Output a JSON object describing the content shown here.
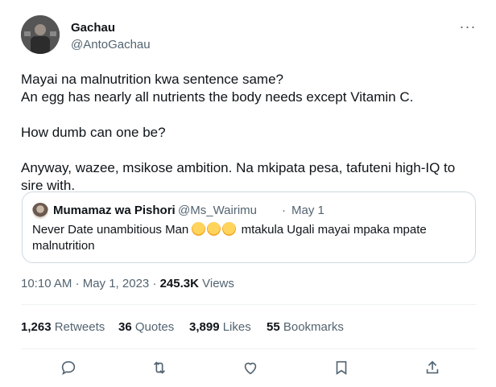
{
  "author": {
    "name": "Gachau",
    "handle": "@AntoGachau",
    "avatar_icon": "profile-photo"
  },
  "more_icon_label": "···",
  "tweet_text": {
    "line1": "Mayai na malnutrition kwa sentence same?",
    "line2": "An egg has nearly all nutrients the body needs except Vitamin C.",
    "line3": "How dumb can one be?",
    "line4": "Anyway, wazee, msikose ambition. Na mkipata pesa, tafuteni high-IQ to sire with."
  },
  "quoted": {
    "name": "Mumamaz wa Pishori",
    "handle": "@Ms_Wairimu",
    "separator": "·",
    "date": "May 1",
    "text_before_emoji": "Never Date unambitious Man ",
    "emoji_icon": "yawning-face-emoji",
    "emoji_count": 3,
    "text_after_emoji": " mtakula Ugali mayai mpaka mpate malnutrition"
  },
  "meta": {
    "time": "10:10 AM · May 1, 2023 · ",
    "views_count": "245.3K",
    "views_label": " Views"
  },
  "stats": {
    "retweets_count": "1,263",
    "retweets_label": " Retweets",
    "quotes_count": "36",
    "quotes_label": " Quotes",
    "likes_count": "3,899",
    "likes_label": " Likes",
    "bookmarks_count": "55",
    "bookmarks_label": " Bookmarks"
  },
  "actions": [
    "reply-icon",
    "retweet-icon",
    "like-icon",
    "bookmark-icon",
    "share-icon"
  ],
  "colors": {
    "text": "#0f1419",
    "secondary": "#536471",
    "border": "#cfd9de",
    "divider": "#eff3f4"
  }
}
